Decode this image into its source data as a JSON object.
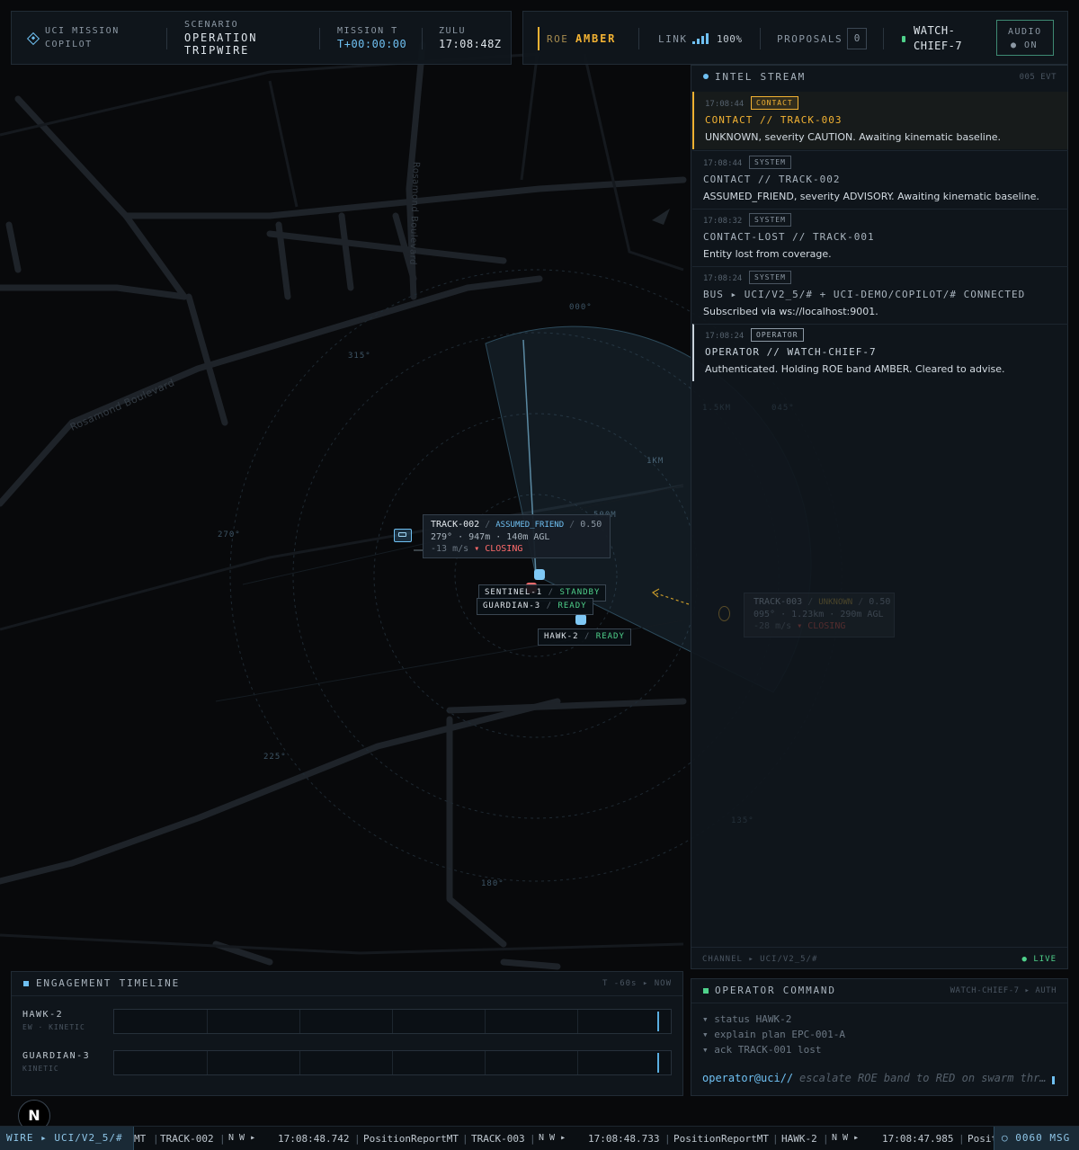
{
  "header": {
    "app_title_line1": "UCI MISSION",
    "app_title_line2": "COPILOT",
    "scenario_label": "SCENARIO",
    "scenario_line1": "OPERATION",
    "scenario_line2": "TRIPWIRE",
    "mission_label": "MISSION T",
    "mission_value": "T+00:00:00",
    "zulu_label": "ZULU",
    "zulu_value": "17:08:48Z",
    "roe_label": "ROE",
    "roe_value": "AMBER",
    "link_label": "LINK",
    "link_value": "100%",
    "proposals_label": "PROPOSALS",
    "proposals_count": "0",
    "operator_line1": "WATCH-",
    "operator_line2": "CHIEF-7",
    "audio_label": "AUDIO",
    "audio_state": "● ON"
  },
  "intel": {
    "title": "INTEL STREAM",
    "count": "005 EVT",
    "events": [
      {
        "time": "17:08:44",
        "badge": "CONTACT",
        "title": "CONTACT // TRACK-003",
        "desc": "UNKNOWN, severity CAUTION. Awaiting kinematic baseline."
      },
      {
        "time": "17:08:44",
        "badge": "SYSTEM",
        "title": "CONTACT // TRACK-002",
        "desc": "ASSUMED_FRIEND, severity ADVISORY. Awaiting kinematic baseline."
      },
      {
        "time": "17:08:32",
        "badge": "SYSTEM",
        "title": "CONTACT-LOST // TRACK-001",
        "desc": "Entity lost from coverage."
      },
      {
        "time": "17:08:24",
        "badge": "SYSTEM",
        "title": "BUS ▸ UCI/V2_5/# + UCI-DEMO/COPILOT/# CONNECTED",
        "desc": "Subscribed via ws://localhost:9001."
      },
      {
        "time": "17:08:24",
        "badge": "OPERATOR",
        "title": "OPERATOR // WATCH-CHIEF-7",
        "desc": "Authenticated. Holding ROE band AMBER. Cleared to advise."
      }
    ],
    "channel": "CHANNEL ▸ UCI/V2_5/#",
    "live": "● LIVE"
  },
  "map": {
    "street_1": "Rosamond Boulevard",
    "street_2": "Rosamond Boulevard",
    "bearings": [
      "000°",
      "315°",
      "270°",
      "225°",
      "180°",
      "135°",
      "045°"
    ],
    "ranges": [
      "1KM",
      "500M",
      "1.5KM"
    ],
    "track002": {
      "name": "TRACK-002",
      "affil": "ASSUMED_FRIEND",
      "conf": "0.50",
      "kin": "279° · 947m · 140m AGL",
      "speed": "-13 m/s",
      "status": "▾ CLOSING"
    },
    "track003": {
      "name": "TRACK-003",
      "affil": "UNKNOWN",
      "conf": "0.50",
      "kin": "095° · 1.23km · 290m AGL",
      "speed": "-28 m/s",
      "status": "▾ CLOSING"
    },
    "units": [
      {
        "name": "SENTINEL-1",
        "state": "STANDBY"
      },
      {
        "name": "GUARDIAN-3",
        "state": "READY"
      },
      {
        "name": "HAWK-2",
        "state": "READY"
      }
    ]
  },
  "timeline": {
    "title": "ENGAGEMENT TIMELINE",
    "range": "T -60s ▸ NOW",
    "lanes": [
      {
        "name": "HAWK-2",
        "sub": "EW · KINETIC"
      },
      {
        "name": "GUARDIAN-3",
        "sub": "KINETIC"
      }
    ]
  },
  "command": {
    "title": "OPERATOR COMMAND",
    "auth": "WATCH-CHIEF-7 ▸ AUTH",
    "suggestions": [
      "▾ status HAWK-2",
      "▾ explain plan EPC-001-A",
      "▾ ack TRACK-001 lost"
    ],
    "prompt": "operator@uci//",
    "placeholder": "escalate ROE band to RED on swarm thr…"
  },
  "ticker": {
    "wire_label": "WIRE ▸ UCI/V2_5/#",
    "items": [
      "MT",
      "TRACK-002",
      "N W ▸",
      "17:08:48.742",
      "PositionReportMT",
      "TRACK-003",
      "N W ▸",
      "17:08:48.733",
      "PositionReportMT",
      "HAWK-2",
      "N W ▸",
      "17:08:47.985",
      "Posit"
    ],
    "msg_count": "○ 0060 MSG"
  },
  "badge_letter": "N",
  "colors": {
    "accent": "#6fc0f2",
    "amber": "#f2b233",
    "ok": "#4fd18b",
    "hostile": "#ff6b6b"
  }
}
